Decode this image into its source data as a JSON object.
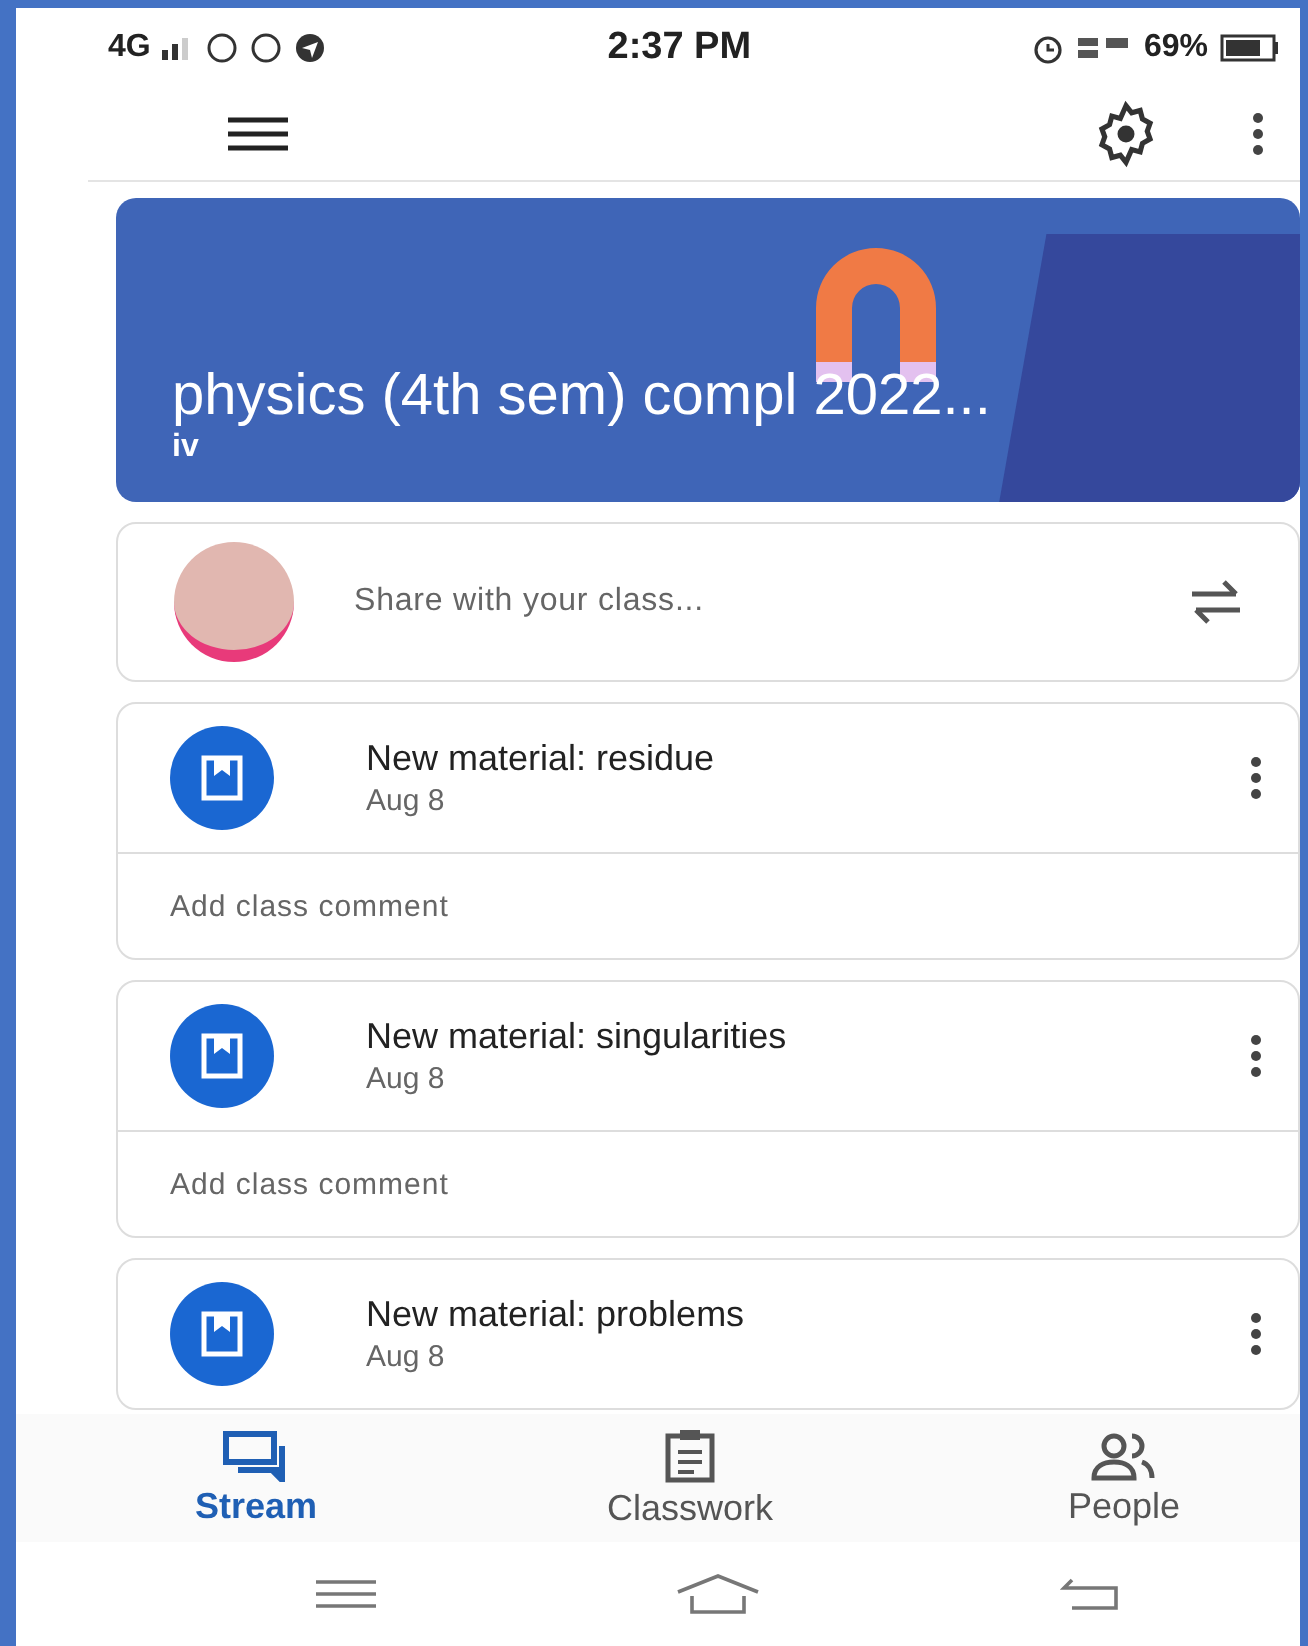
{
  "status_bar": {
    "network": "4G",
    "time": "2:37 PM",
    "battery": "69%"
  },
  "class_banner": {
    "title": "physics (4th sem) compl 2022...",
    "section": "iv"
  },
  "share": {
    "placeholder": "Share with your class..."
  },
  "posts": [
    {
      "title": "New material: residue",
      "date": "Aug 8",
      "comment_placeholder": "Add class comment"
    },
    {
      "title": "New material: singularities",
      "date": "Aug 8",
      "comment_placeholder": "Add class comment"
    },
    {
      "title": "New material: problems",
      "date": "Aug 8"
    }
  ],
  "tabs": [
    {
      "label": "Stream",
      "kind": "stream",
      "selected": true
    },
    {
      "label": "Classwork",
      "kind": "classwork",
      "selected": false
    },
    {
      "label": "People",
      "kind": "people",
      "selected": false
    }
  ]
}
